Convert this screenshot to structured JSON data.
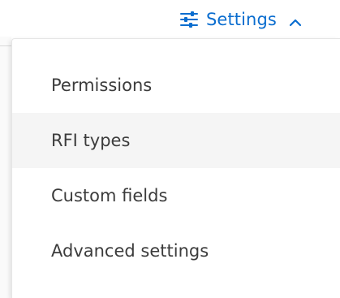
{
  "header": {
    "settings_label": "Settings",
    "settings_icon": "sliders-icon",
    "chevron_icon": "chevron-up-icon",
    "accent_color": "#0a6dcf"
  },
  "menu": {
    "items": [
      {
        "label": "Permissions"
      },
      {
        "label": "RFI types",
        "state": "hovered"
      },
      {
        "label": "Custom fields"
      },
      {
        "label": "Advanced settings"
      }
    ],
    "hover_color": "#f5f5f5"
  }
}
